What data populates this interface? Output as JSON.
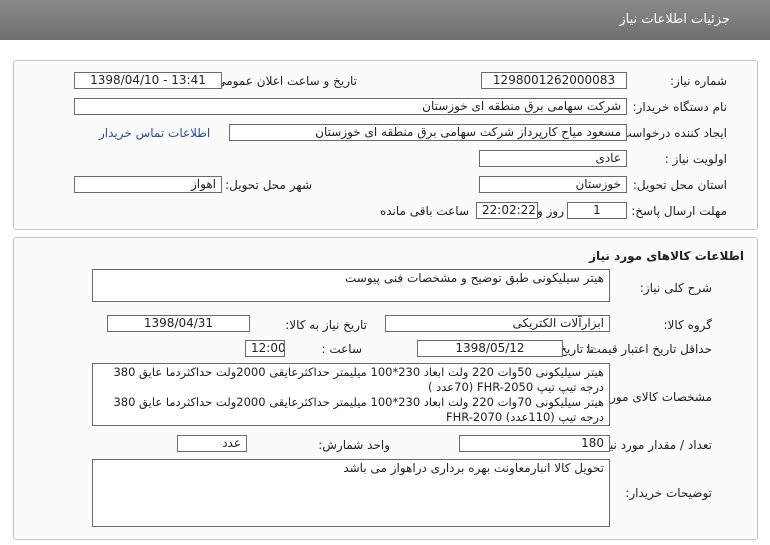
{
  "header": {
    "title": "جزئیات اطلاعات نیاز"
  },
  "info": {
    "need_number_label": "شماره نیاز:",
    "need_number": "1298001262000083",
    "announce_label": "تاریخ و ساعت اعلان عمومی:",
    "announce_value": "1398/04/10 - 13:41",
    "buyer_org_label": "نام دستگاه خریدار:",
    "buyer_org": "شرکت سهامی برق منطقه ای خوزستان",
    "requester_label": "ایجاد کننده درخواست:",
    "requester": "مسعود میاح کارپرداز شرکت سهامی برق منطقه ای خوزستان",
    "contact_link": "اطلاعات تماس خریدار",
    "priority_label": "اولویت نیاز :",
    "priority": "عادی",
    "province_label": "استان محل تحویل:",
    "province": "خوزستان",
    "city_label": "شهر محل تحویل:",
    "city": "اهواز",
    "deadline_label": "مهلت ارسال پاسخ:",
    "days": "1",
    "days_label": "روز و",
    "time": "22:02:22",
    "remaining_label": "ساعت باقی مانده"
  },
  "goods": {
    "section_title": "اطلاعات کالاهای مورد نیاز",
    "summary_label": "شرح کلی نیاز:",
    "summary": "هیتر سیلیکونی طبق توضیح و  مشخصات فنی پیوست",
    "group_label": "گروه کالا:",
    "group": "ابزارآلات الکتریکی",
    "need_date_label": "تاریخ نیاز به کالا:",
    "need_date": "1398/04/31",
    "validity_label": "حداقل تاریخ اعتبار قیمت:",
    "until_date_label": "تا تاریخ :",
    "until_date": "1398/05/12",
    "hour_label": "ساعت :",
    "hour": "12:00",
    "spec_label": "مشخصات کالای مورد نیاز:",
    "spec_lines": [
      "هیتر سیلیکونی 50وات 220 ولت ابعاد 230*100 میلیمتر حداکثرعایقی 2000ولت حداکثردما عایق 380",
      "درجه تیپ تیپ  FHR-2050 (70عدد )",
      "هیتر سیلیکونی 70وات 220 ولت ابعاد 230*100 میلیمتر حداکثرعایقی 2000ولت حداکثردما عایق 380",
      "درجه تیپ  (110عدد) FHR-2070"
    ],
    "qty_label": "تعداد / مقدار مورد نیاز:",
    "qty": "180",
    "unit_label": "واحد شمارش:",
    "unit": "عدد",
    "buyer_notes_label": "توضیحات خریدار:",
    "buyer_notes": "تحویل کالا انبارمعاونت بهره برداری دراهواز می باشد"
  }
}
